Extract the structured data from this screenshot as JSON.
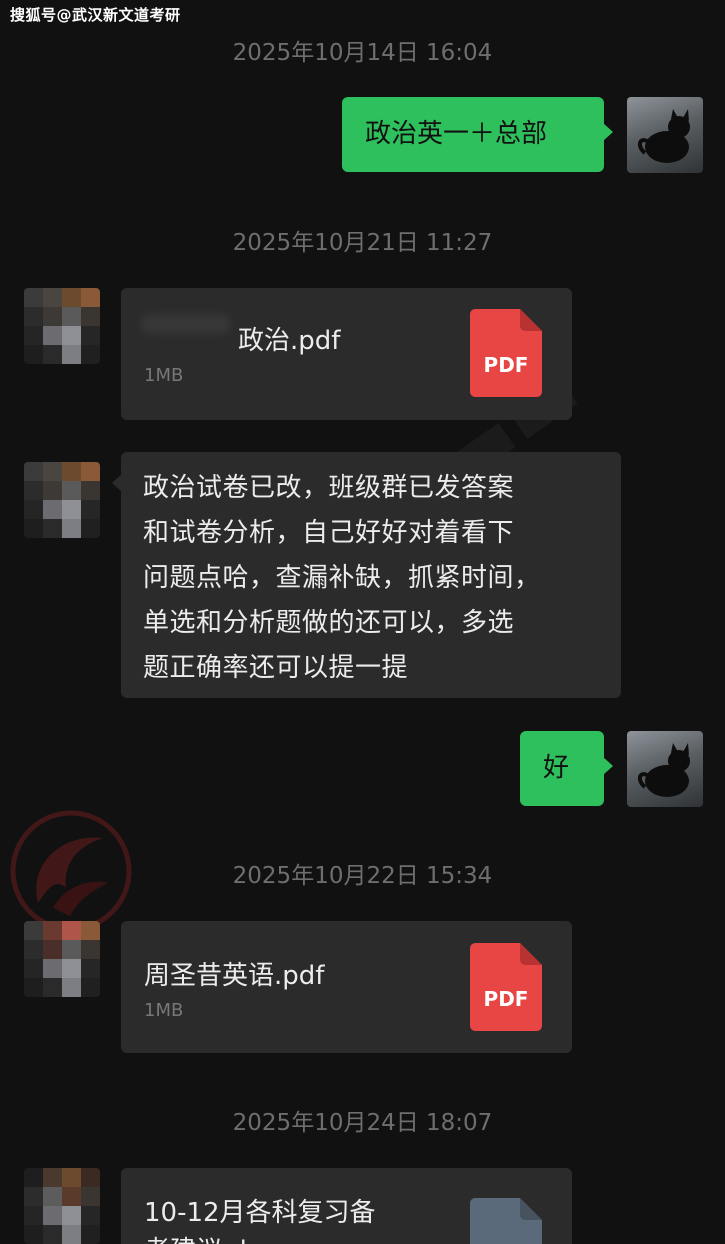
{
  "source_label": "搜狐号@武汉新文道考研",
  "colors": {
    "background": "#111111",
    "self_bubble": "#2ec05d",
    "other_bubble": "#2b2b2b",
    "pdf_icon": "#e84545",
    "doc_icon": "#5b6a7a",
    "timestamp": "#6e6e6e"
  },
  "messages": [
    {
      "type": "timestamp",
      "text": "2025年10月14日 16:04"
    },
    {
      "type": "self_text",
      "text": "政治英一＋总部",
      "avatar_icon": "black-cat-avatar"
    },
    {
      "type": "timestamp",
      "text": "2025年10月21日 11:27"
    },
    {
      "type": "other_file",
      "file_name": "政治.pdf",
      "file_size": "1MB",
      "file_icon": "pdf-icon",
      "file_icon_label": "PDF"
    },
    {
      "type": "other_text",
      "lines": [
        "政治试卷已改，班级群已发答案",
        "和试卷分析，自己好好对着看下",
        "问题点哈，查漏补缺，抓紧时间，",
        "单选和分析题做的还可以，多选",
        "题正确率还可以提一提"
      ]
    },
    {
      "type": "self_text",
      "text": "好",
      "avatar_icon": "black-cat-avatar"
    },
    {
      "type": "timestamp",
      "text": "2025年10月22日 15:34"
    },
    {
      "type": "other_file",
      "file_name": "周圣昔英语.pdf",
      "file_size": "1MB",
      "file_icon": "pdf-icon",
      "file_icon_label": "PDF"
    },
    {
      "type": "timestamp",
      "text": "2025年10月24日 18:07"
    },
    {
      "type": "other_file",
      "file_name_lines": [
        "10-12月各科复习备",
        "考建议.doc"
      ],
      "file_icon": "doc-icon"
    }
  ]
}
